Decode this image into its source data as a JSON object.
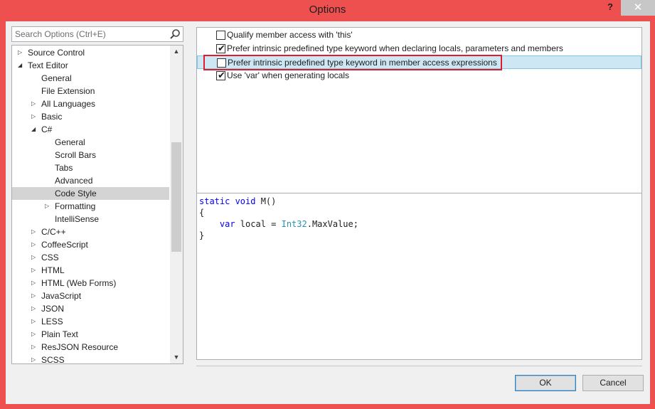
{
  "window": {
    "title": "Options",
    "help": "?",
    "close": "✕"
  },
  "search": {
    "placeholder": "Search Options (Ctrl+E)"
  },
  "tree": [
    {
      "label": "Source Control",
      "level": 0,
      "expander": "collapsed"
    },
    {
      "label": "Text Editor",
      "level": 0,
      "expander": "expanded"
    },
    {
      "label": "General",
      "level": 1,
      "expander": "none"
    },
    {
      "label": "File Extension",
      "level": 1,
      "expander": "none"
    },
    {
      "label": "All Languages",
      "level": 1,
      "expander": "collapsed"
    },
    {
      "label": "Basic",
      "level": 1,
      "expander": "collapsed"
    },
    {
      "label": "C#",
      "level": 1,
      "expander": "expanded"
    },
    {
      "label": "General",
      "level": 2,
      "expander": "none"
    },
    {
      "label": "Scroll Bars",
      "level": 2,
      "expander": "none"
    },
    {
      "label": "Tabs",
      "level": 2,
      "expander": "none"
    },
    {
      "label": "Advanced",
      "level": 2,
      "expander": "none"
    },
    {
      "label": "Code Style",
      "level": 2,
      "expander": "none",
      "selected": true
    },
    {
      "label": "Formatting",
      "level": 2,
      "expander": "collapsed"
    },
    {
      "label": "IntelliSense",
      "level": 2,
      "expander": "none"
    },
    {
      "label": "C/C++",
      "level": 1,
      "expander": "collapsed"
    },
    {
      "label": "CoffeeScript",
      "level": 1,
      "expander": "collapsed"
    },
    {
      "label": "CSS",
      "level": 1,
      "expander": "collapsed"
    },
    {
      "label": "HTML",
      "level": 1,
      "expander": "collapsed"
    },
    {
      "label": "HTML (Web Forms)",
      "level": 1,
      "expander": "collapsed"
    },
    {
      "label": "JavaScript",
      "level": 1,
      "expander": "collapsed"
    },
    {
      "label": "JSON",
      "level": 1,
      "expander": "collapsed"
    },
    {
      "label": "LESS",
      "level": 1,
      "expander": "collapsed"
    },
    {
      "label": "Plain Text",
      "level": 1,
      "expander": "collapsed"
    },
    {
      "label": "ResJSON Resource",
      "level": 1,
      "expander": "collapsed"
    },
    {
      "label": "SCSS",
      "level": 1,
      "expander": "collapsed"
    }
  ],
  "options": [
    {
      "label": "Qualify member access with 'this'",
      "checked": false
    },
    {
      "label": "Prefer intrinsic predefined type keyword when declaring locals, parameters and members",
      "checked": true
    },
    {
      "label": "Prefer intrinsic predefined type keyword in member access expressions",
      "checked": false,
      "selected": true
    },
    {
      "label": "Use 'var' when generating locals",
      "checked": true
    }
  ],
  "preview": {
    "line1_kw": "static void",
    "line1_rest": " M()",
    "line2": "{",
    "line3_kw": "    var",
    "line3_mid": " local = ",
    "line3_type": "Int32",
    "line3_rest": ".MaxValue;",
    "line4": "}"
  },
  "buttons": {
    "ok": "OK",
    "cancel": "Cancel"
  },
  "colors": {
    "titlebar": "#ee4f4f",
    "selection": "#cde8f4",
    "highlight": "#e21b2a",
    "keyword": "#0000ff",
    "type": "#2b91af"
  }
}
